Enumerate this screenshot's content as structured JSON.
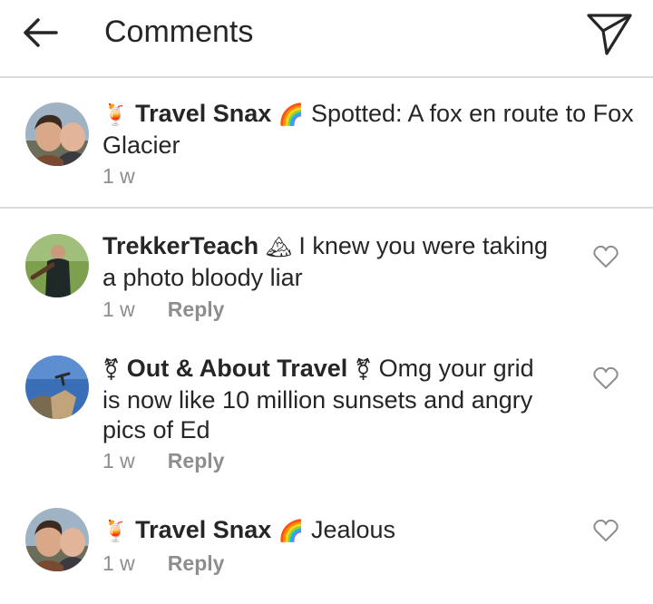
{
  "header": {
    "title": "Comments",
    "back_icon": "arrow-left-icon",
    "send_icon": "paper-plane-icon"
  },
  "caption": {
    "emoji_left": "🍹",
    "username": "Travel Snax",
    "emoji_right": "🌈",
    "text": "Spotted: A fox en route to Fox",
    "text_line2": "Glacier",
    "time": "1 w"
  },
  "comments": [
    {
      "username": "TrekkerTeach",
      "badge": "🏔",
      "line1": "I knew you were taking",
      "line2": "a photo bloody liar",
      "time": "1 w",
      "reply": "Reply",
      "like_icon": "heart-outline-icon"
    },
    {
      "badge_left": "⚧",
      "username": "Out & About Travel",
      "badge_right": "⚧",
      "line1": "Omg your grid",
      "line2": "is now like 10 million sunsets and angry",
      "line3": "pics of Ed",
      "time": "1 w",
      "reply": "Reply",
      "like_icon": "heart-outline-icon"
    },
    {
      "emoji_left": "🍹",
      "username": "Travel Snax",
      "emoji_right": "🌈",
      "line1": "Jealous",
      "time": "1 w",
      "reply": "Reply",
      "like_icon": "heart-outline-icon"
    }
  ],
  "colors": {
    "text": "#262626",
    "secondary": "#8e8e8e",
    "divider": "#dbdbdb"
  }
}
